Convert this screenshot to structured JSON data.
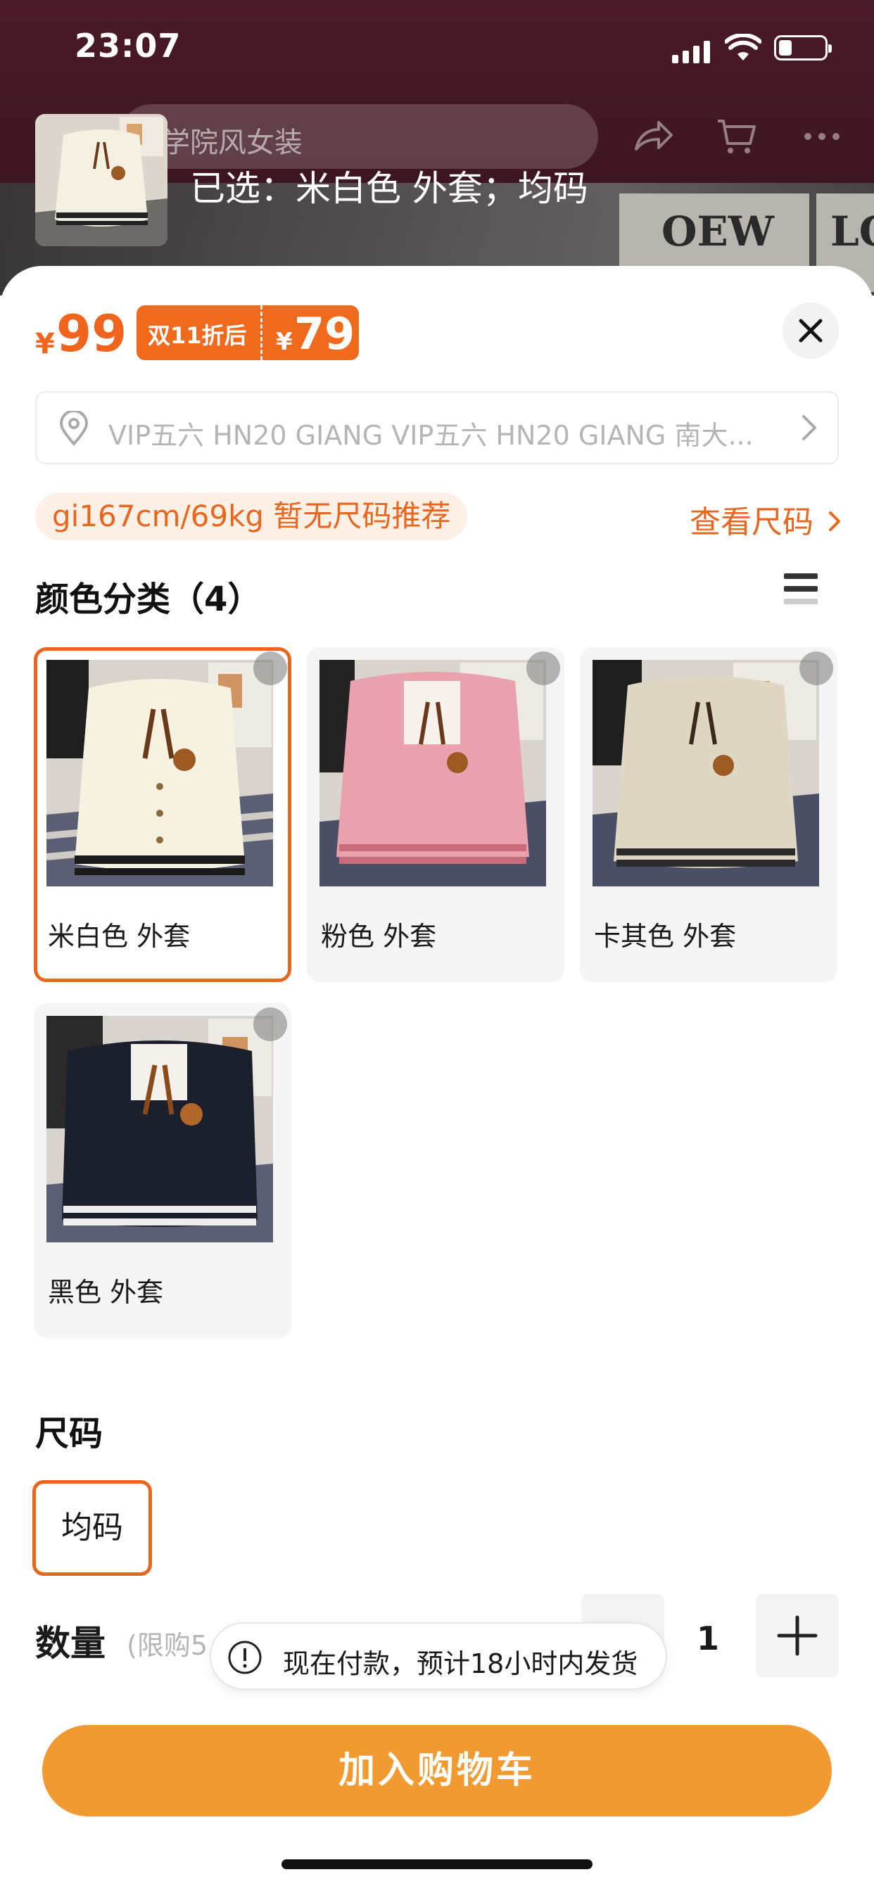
{
  "status_bar": {
    "time": "23:07"
  },
  "header": {
    "search_placeholder": "学院风女装",
    "selected_text": "已选：米白色 外套；均码"
  },
  "price": {
    "currency": "¥",
    "original": "99",
    "promo_label": "双11折后",
    "promo_currency": "¥",
    "promo_price": "79"
  },
  "address": {
    "text": "VIP五六 HN20 GIANG VIP五六 HN20 GIANG 南大..."
  },
  "size_recommendation": {
    "text": "gi167cm/69kg 暂无尺码推荐",
    "guide_link": "查看尺码"
  },
  "color_section": {
    "title": "颜色分类（4）",
    "options": [
      {
        "label": "米白色 外套",
        "selected": true,
        "color": "#f3eedc"
      },
      {
        "label": "粉色 外套",
        "selected": false,
        "color": "#e8a3ab"
      },
      {
        "label": "卡其色 外套",
        "selected": false,
        "color": "#d9d3bf"
      },
      {
        "label": "黑色 外套",
        "selected": false,
        "color": "#1b1e2b"
      }
    ]
  },
  "size_section": {
    "title": "尺码",
    "options": [
      {
        "label": "均码",
        "selected": true
      }
    ]
  },
  "quantity": {
    "label": "数量",
    "limit": "(限购5",
    "value": "1"
  },
  "toast": {
    "text": "现在付款，预计18小时内发货"
  },
  "cta": {
    "label": "加入购物车"
  },
  "colors": {
    "accent": "#e8661e",
    "cta": "#f29a32"
  }
}
